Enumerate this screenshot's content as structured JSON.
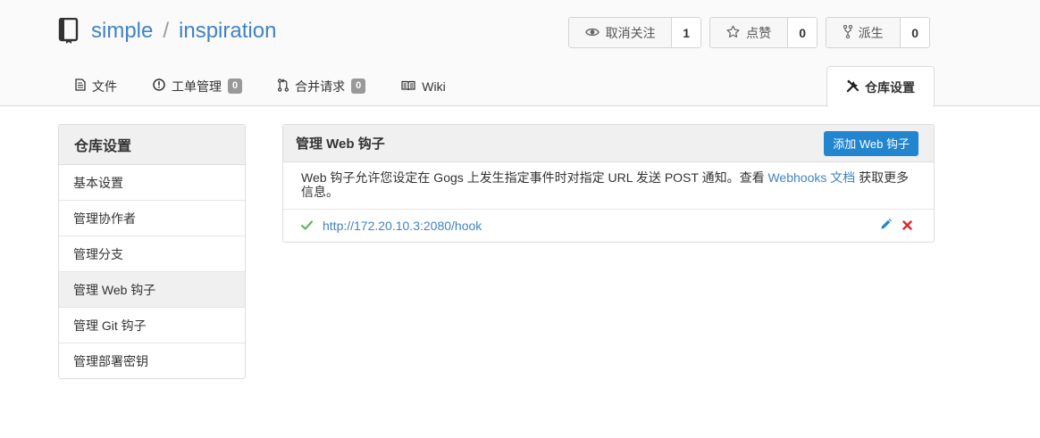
{
  "repo": {
    "owner": "simple",
    "separator": "/",
    "name": "inspiration",
    "icon": "repo-book-icon"
  },
  "actions": {
    "watch": {
      "label": "取消关注",
      "count": "1",
      "icon": "eye-icon"
    },
    "star": {
      "label": "点赞",
      "count": "0",
      "icon": "star-icon"
    },
    "fork": {
      "label": "派生",
      "count": "0",
      "icon": "fork-icon"
    }
  },
  "tabs": [
    {
      "label": "文件",
      "icon": "file-text-icon"
    },
    {
      "label": "工单管理",
      "badge": "0",
      "icon": "issue-opened-icon"
    },
    {
      "label": "合并请求",
      "badge": "0",
      "icon": "pull-request-icon"
    },
    {
      "label": "Wiki",
      "icon": "book-icon"
    }
  ],
  "active_tab": {
    "label": "仓库设置",
    "icon": "tools-icon"
  },
  "sidebar": {
    "title": "仓库设置",
    "items": [
      {
        "label": "基本设置"
      },
      {
        "label": "管理协作者"
      },
      {
        "label": "管理分支"
      },
      {
        "label": "管理 Web 钩子",
        "active": true
      },
      {
        "label": "管理 Git 钩子"
      },
      {
        "label": "管理部署密钥"
      }
    ]
  },
  "panel": {
    "title": "管理 Web 钩子",
    "add_button": "添加 Web 钩子",
    "desc_before": "Web 钩子允许您设定在 Gogs 上发生指定事件时对指定 URL 发送 POST 通知。查看 ",
    "desc_link": "Webhooks 文档",
    "desc_after": " 获取更多信息。",
    "hooks": [
      {
        "url": "http://172.20.10.3:2080/hook",
        "status_icon": "check-icon"
      }
    ]
  },
  "colors": {
    "link": "#4183c4",
    "primary": "#2185d0",
    "success": "#5cb85c",
    "danger": "#db2828",
    "badge": "#999999"
  }
}
